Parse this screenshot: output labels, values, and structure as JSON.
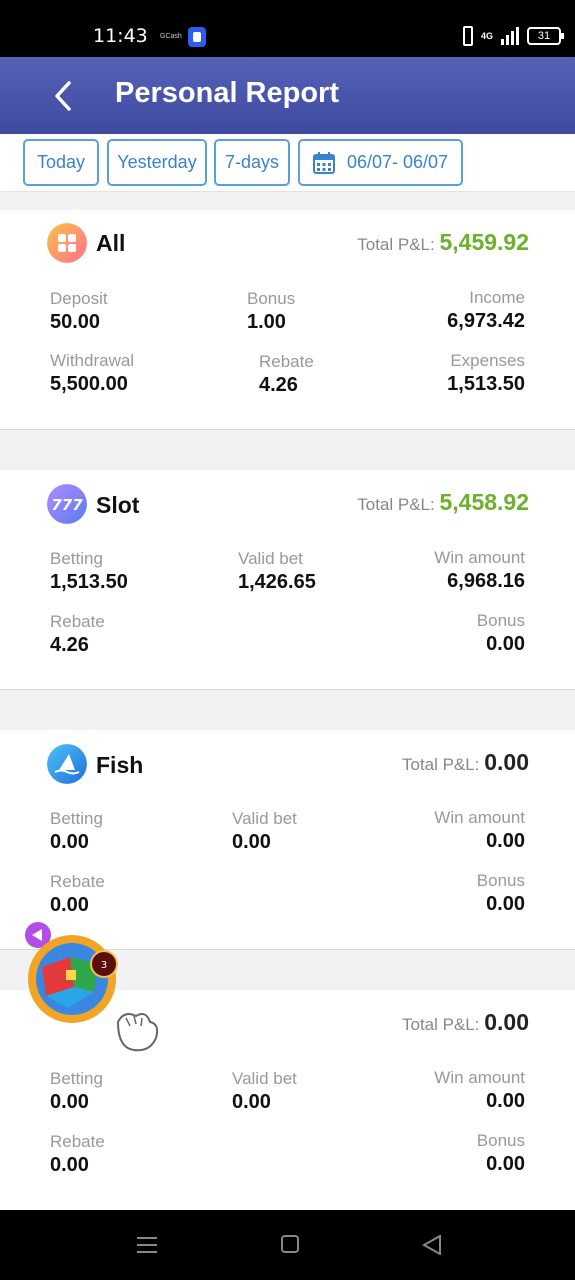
{
  "status": {
    "time": "11:43",
    "gcash": "GCash",
    "network": "4G",
    "battery": "31"
  },
  "header": {
    "title": "Personal Report"
  },
  "filters": {
    "today": "Today",
    "yesterday": "Yesterday",
    "week": "7-days",
    "range": "06/07- 06/07"
  },
  "colors": {
    "header": "#4753a9",
    "accent": "#3a82cf",
    "positive": "#6bb12b"
  },
  "sections": [
    {
      "title": "All",
      "pl_label": "Total P&L:",
      "pl_value": "5,459.92",
      "r1": [
        {
          "label": "Deposit",
          "value": "50.00"
        },
        {
          "label": "Bonus",
          "value": "1.00"
        },
        {
          "label": "Income",
          "value": "6,973.42"
        }
      ],
      "r2": [
        {
          "label": "Withdrawal",
          "value": "5,500.00"
        },
        {
          "label": "Rebate",
          "value": "4.26"
        },
        {
          "label": "Expenses",
          "value": "1,513.50"
        }
      ]
    },
    {
      "title": "Slot",
      "pl_label": "Total P&L:",
      "pl_value": "5,458.92",
      "r1": [
        {
          "label": "Betting",
          "value": "1,513.50"
        },
        {
          "label": "Valid bet",
          "value": "1,426.65"
        },
        {
          "label": "Win amount",
          "value": "6,968.16"
        }
      ],
      "r2": [
        {
          "label": "Rebate",
          "value": "4.26"
        },
        {
          "label": "Bonus",
          "value": "0.00"
        }
      ]
    },
    {
      "title": "Fish",
      "pl_label": "Total P&L:",
      "pl_value": "0.00",
      "r1": [
        {
          "label": "Betting",
          "value": "0.00"
        },
        {
          "label": "Valid bet",
          "value": "0.00"
        },
        {
          "label": "Win amount",
          "value": "0.00"
        }
      ],
      "r2": [
        {
          "label": "Rebate",
          "value": "0.00"
        },
        {
          "label": "Bonus",
          "value": "0.00"
        }
      ]
    },
    {
      "title": "",
      "pl_label": "Total P&L:",
      "pl_value": "0.00",
      "r1": [
        {
          "label": "Betting",
          "value": "0.00"
        },
        {
          "label": "Valid bet",
          "value": "0.00"
        },
        {
          "label": "Win amount",
          "value": "0.00"
        }
      ],
      "r2": [
        {
          "label": "Rebate",
          "value": "0.00"
        },
        {
          "label": "Bonus",
          "value": "0.00"
        }
      ]
    }
  ],
  "floating": {
    "badge_count": "3"
  }
}
